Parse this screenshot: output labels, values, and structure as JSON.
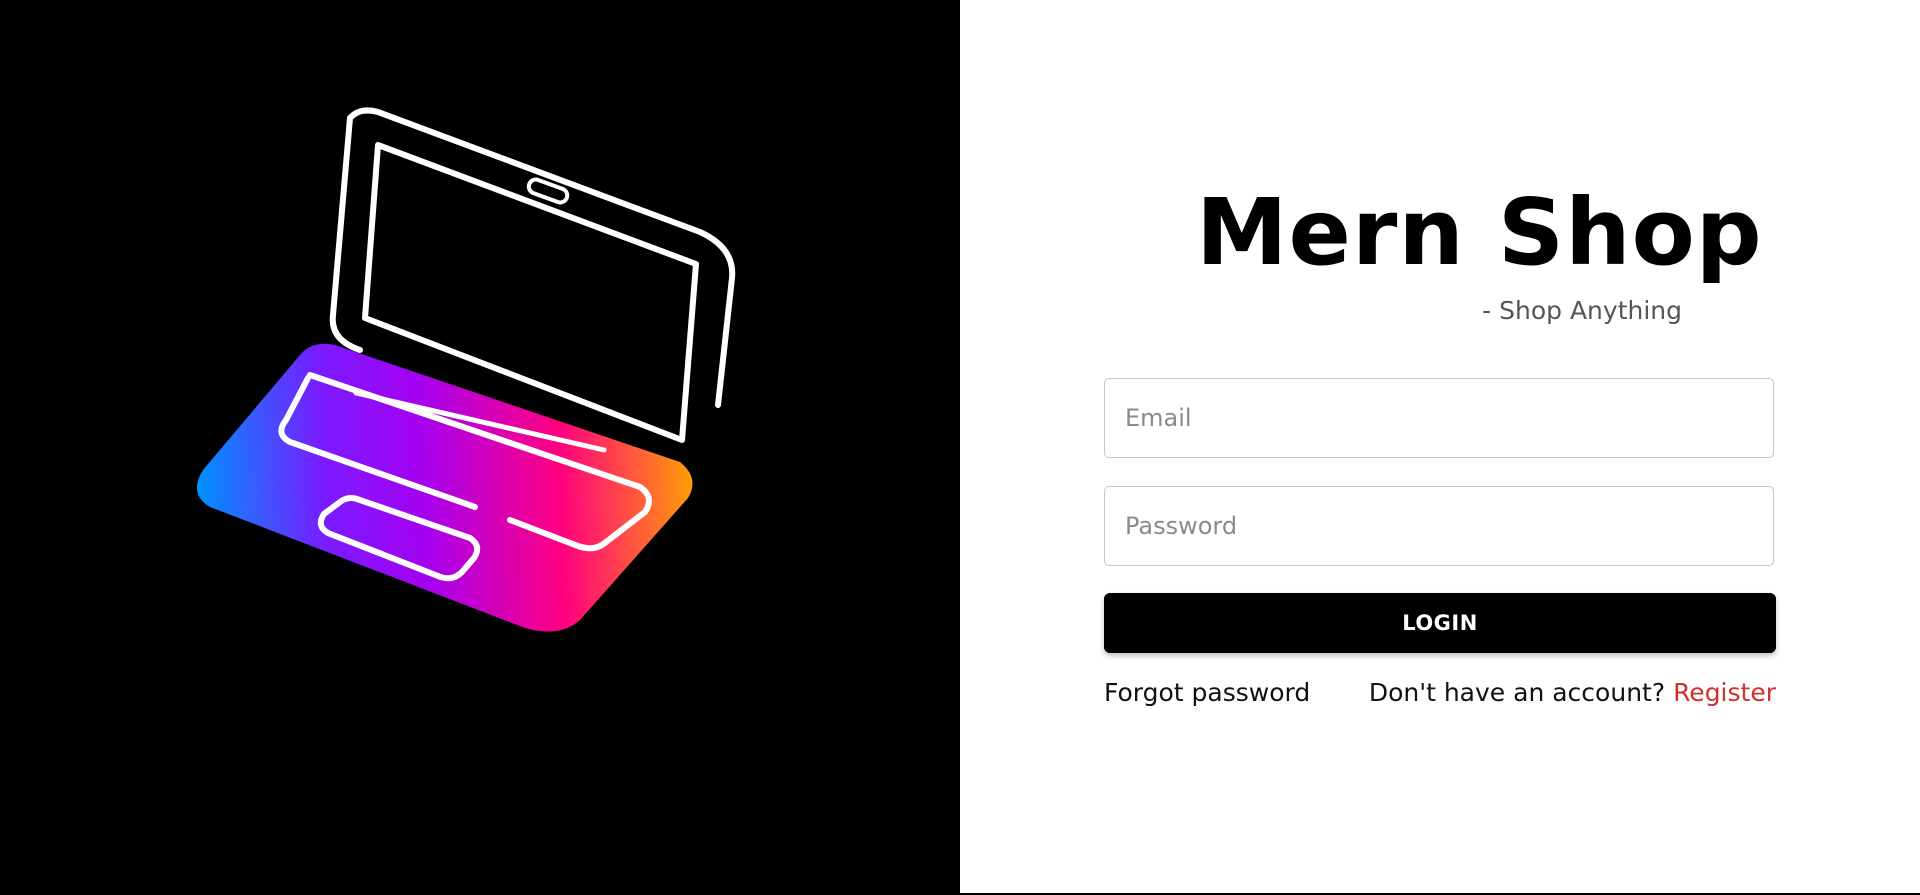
{
  "illustration": {
    "icon": "laptop-icon",
    "gradient_colors": [
      "#0090ff",
      "#9b00ff",
      "#ff0080",
      "#ffa600"
    ]
  },
  "brand": {
    "title": "Mern Shop",
    "tagline": "- Shop Anything"
  },
  "form": {
    "email_placeholder": "Email",
    "email_value": "",
    "password_placeholder": "Password",
    "password_value": "",
    "login_label": "LOGIN",
    "forgot_label": "Forgot password",
    "register_prompt": "Don't have an account? ",
    "register_label": "Register"
  },
  "colors": {
    "accent": "#d32f2f",
    "primary_button": "#000000"
  }
}
